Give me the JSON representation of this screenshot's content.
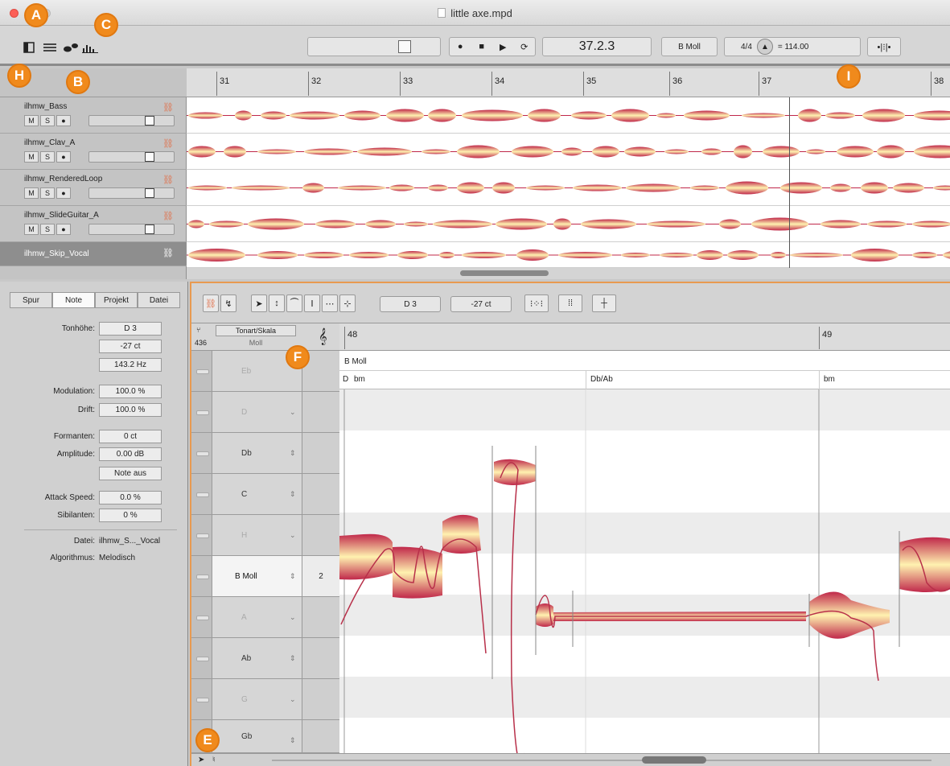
{
  "window": {
    "title": "little axe.mpd"
  },
  "toolbar": {
    "position": "37.2.3",
    "key": "B Moll",
    "meter": "4/4",
    "tempo": "= 114.00"
  },
  "callouts": {
    "a": "A",
    "b": "B",
    "c": "C",
    "e": "E",
    "f": "F",
    "h": "H",
    "i": "I"
  },
  "ruler_top": [
    "31",
    "32",
    "33",
    "34",
    "35",
    "36",
    "37",
    "38"
  ],
  "tracks": [
    {
      "name": "ilhmw_Bass",
      "m": "M",
      "s": "S"
    },
    {
      "name": "ilhmw_Clav_A",
      "m": "M",
      "s": "S"
    },
    {
      "name": "ilhmw_RenderedLoop",
      "m": "M",
      "s": "S"
    },
    {
      "name": "ilhmw_SlideGuitar_A",
      "m": "M",
      "s": "S"
    },
    {
      "name": "ilhmw_Skip_Vocal"
    }
  ],
  "inspector": {
    "tabs": [
      "Spur",
      "Note",
      "Projekt",
      "Datei"
    ],
    "pitch_label": "Tonhöhe:",
    "pitch_note": "D 3",
    "pitch_cents": "-27 ct",
    "pitch_hz": "143.2 Hz",
    "modulation_label": "Modulation:",
    "modulation_value": "100.0 %",
    "drift_label": "Drift:",
    "drift_value": "100.0 %",
    "formants_label": "Formanten:",
    "formants_value": "0 ct",
    "amplitude_label": "Amplitude:",
    "amplitude_value": "0.00 dB",
    "note_off": "Note aus",
    "attack_label": "Attack Speed:",
    "attack_value": "0.0 %",
    "sibilants_label": "Sibilanten:",
    "sibilants_value": "0 %",
    "file_label": "Datei:",
    "file_value": "ilhmw_S..._Vocal",
    "algorithm_label": "Algorithmus:",
    "algorithm_value": "Melodisch"
  },
  "editor": {
    "note_field": "D 3",
    "cents_field": "-27 ct",
    "scale_head": {
      "label": "Tonart/Skala",
      "ref": "436",
      "mode": "Moll"
    },
    "ruler": [
      "48",
      "49"
    ],
    "key_name": "B Moll",
    "chords": [
      "bm",
      "Db/Ab",
      "bm"
    ],
    "chord_prefix": "D",
    "pitch_rows": [
      {
        "name": "Eb",
        "style": "dim",
        "num": ""
      },
      {
        "name": "D",
        "style": "dim",
        "num": ""
      },
      {
        "name": "Db",
        "style": "",
        "num": ""
      },
      {
        "name": "C",
        "style": "",
        "num": ""
      },
      {
        "name": "H",
        "style": "dim",
        "num": ""
      },
      {
        "name": "B Moll",
        "style": "sel",
        "num": "2"
      },
      {
        "name": "A",
        "style": "dim",
        "num": ""
      },
      {
        "name": "Ab",
        "style": "",
        "num": ""
      },
      {
        "name": "G",
        "style": "dim",
        "num": ""
      },
      {
        "name": "Gb",
        "style": "",
        "num": ""
      }
    ]
  },
  "colors": {
    "accent": "#f08a1c",
    "blob_dark": "#c0284a",
    "blob_light": "#fff2b0"
  }
}
